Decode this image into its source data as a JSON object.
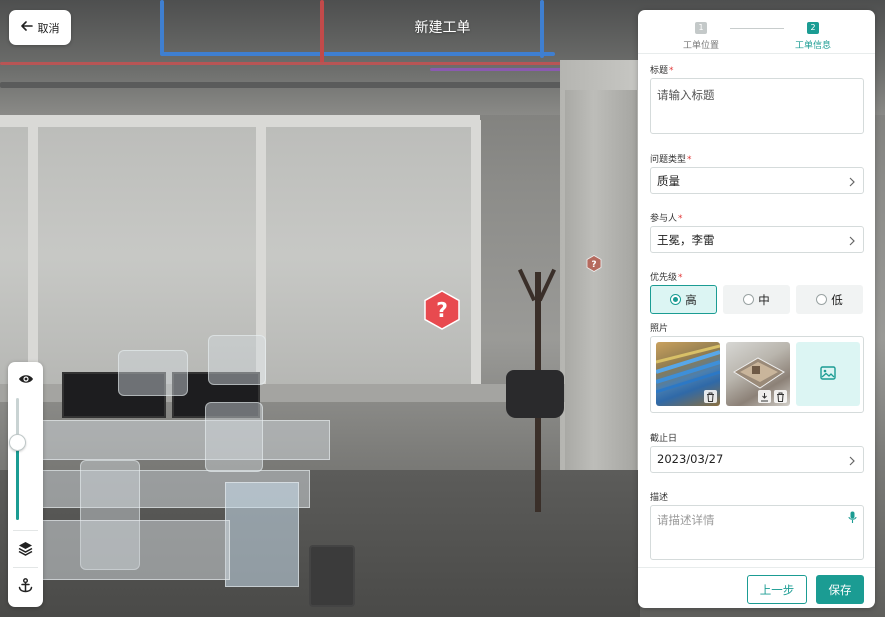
{
  "header": {
    "cancel_label": "取消",
    "title": "新建工单"
  },
  "steps": [
    {
      "number": "1",
      "label": "工单位置",
      "state": "done"
    },
    {
      "number": "2",
      "label": "工单信息",
      "state": "active"
    }
  ],
  "form": {
    "title": {
      "label": "标题",
      "required": "*",
      "placeholder": "请输入标题"
    },
    "issue_type": {
      "label": "问题类型",
      "required": "*",
      "value": "质量"
    },
    "participants": {
      "label": "参与人",
      "required": "*",
      "value": "王冕，李雷"
    },
    "priority": {
      "label": "优先级",
      "required": "*",
      "options": [
        {
          "label": "高",
          "selected": true
        },
        {
          "label": "中",
          "selected": false
        },
        {
          "label": "低",
          "selected": false
        }
      ]
    },
    "photos": {
      "label": "照片",
      "count": 2
    },
    "due_date": {
      "label": "截止日",
      "value": "2023/03/27"
    },
    "description": {
      "label": "描述",
      "placeholder": "请描述详情"
    }
  },
  "footer": {
    "prev_label": "上一步",
    "save_label": "保存"
  },
  "toolbar": {
    "icons": [
      "eye-icon",
      "layers-icon",
      "anchor-icon"
    ]
  },
  "colors": {
    "accent": "#1b9c93",
    "accent_light": "#dcf5f3",
    "required": "#e23b3b",
    "marker": "#e84a4f",
    "step_inactive": "#c4c9c9"
  }
}
